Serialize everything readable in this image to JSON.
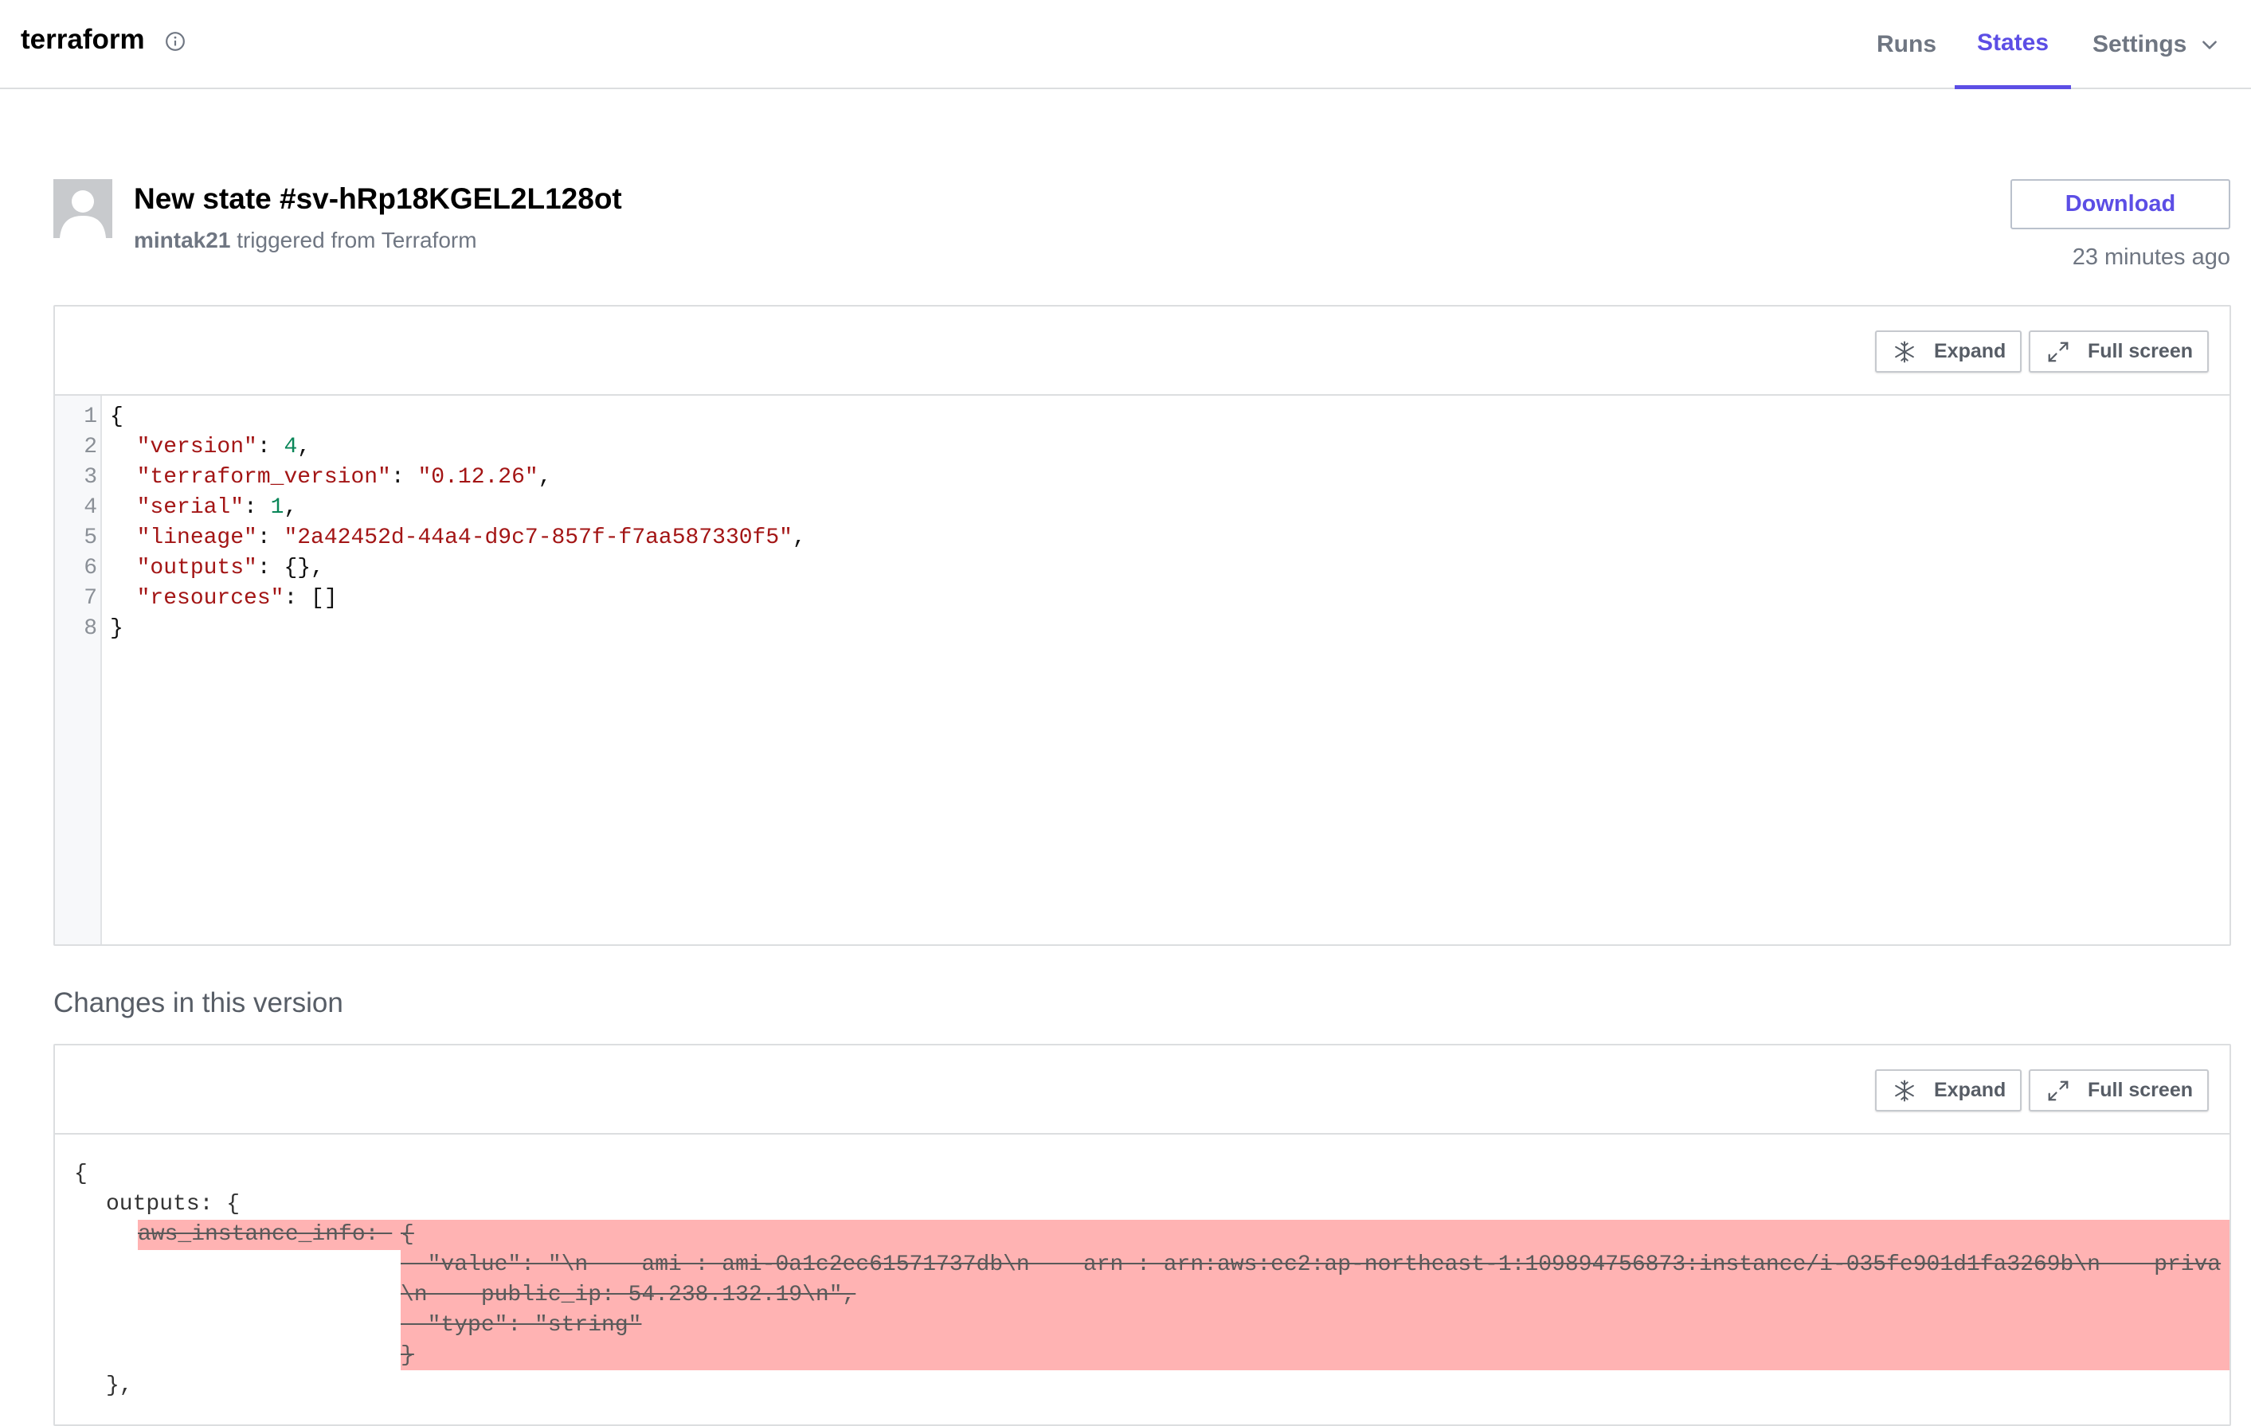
{
  "topbar": {
    "workspace_title": "terraform",
    "nav": {
      "runs": "Runs",
      "states": "States",
      "settings": "Settings"
    },
    "active_tab": "States",
    "accent_color": "#5c4ee5"
  },
  "header": {
    "state_title": "New state #sv-hRp18KGEL2L128ot",
    "user": "mintak21",
    "trigger_text": "triggered from Terraform",
    "download_label": "Download",
    "timestamp": "23 minutes ago"
  },
  "state_panel": {
    "expand_label": "Expand",
    "fullscreen_label": "Full screen",
    "line_numbers": [
      "1",
      "2",
      "3",
      "4",
      "5",
      "6",
      "7",
      "8"
    ],
    "lines": [
      "{",
      "  \"version\": 4,",
      "  \"terraform_version\": \"0.12.26\",",
      "  \"serial\": 1,",
      "  \"lineage\": \"2a42452d-44a4-d9c7-857f-f7aa587330f5\",",
      "  \"outputs\": {},",
      "  \"resources\": []",
      "}"
    ]
  },
  "changes": {
    "section_title": "Changes in this version",
    "expand_label": "Expand",
    "fullscreen_label": "Full screen",
    "diff_lines": {
      "open": "{",
      "outputs": "outputs: {",
      "removed_key": "aws_instance_info: ",
      "removed_open": "{",
      "removed_value": "  \"value\": \"\\n    ami : ami-0a1c2ec61571737db\\n    arn : arn:aws:ec2:ap-northeast-1:109894756873:instance/i-035fe901d1fa3269b\\n    priva",
      "removed_value_cont": "\\n    public_ip: 54.238.132.19\\n\",",
      "removed_type": "  \"type\": \"string\"",
      "removed_close": "}",
      "outputs_close": "},"
    },
    "removed_color": "#ffb3b3"
  }
}
